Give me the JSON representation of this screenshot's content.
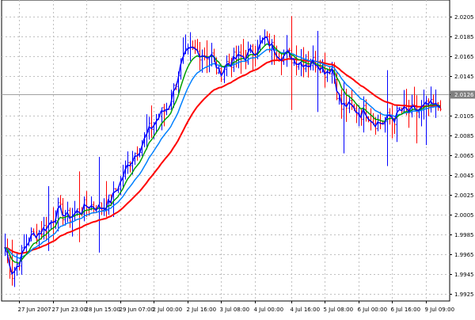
{
  "chart_data": {
    "type": "line",
    "title": "",
    "xlabel": "",
    "ylabel": "",
    "ylim": [
      1.9918,
      2.0215
    ],
    "grid": true,
    "legend": "none",
    "colors": {
      "price": "#0000ff",
      "bar_up": "#0000ff",
      "bar_down": "#ff0000",
      "ma_fast": "#00a000",
      "ma_mid": "#0080ff",
      "ma_slow": "#ff0000",
      "grid": "#c0c0c0",
      "current_line": "#a0a0a0",
      "current_label_bg": "#808080"
    },
    "yticks": [
      "2.0205",
      "2.0185",
      "2.0165",
      "2.0145",
      "2.0126",
      "2.0105",
      "2.0085",
      "2.0065",
      "2.0045",
      "2.0025",
      "2.0005",
      "1.9985",
      "1.9965",
      "1.9945",
      "1.9925"
    ],
    "ytick_values": [
      2.0205,
      2.0185,
      2.0165,
      2.0145,
      2.0126,
      2.0105,
      2.0085,
      2.0065,
      2.0045,
      2.0025,
      2.0005,
      1.9985,
      1.9965,
      1.9945,
      1.9925
    ],
    "current_price": 2.0126,
    "current_price_label": "2.0126",
    "xticks": [
      {
        "label": "27 Jun 2007",
        "i": 6
      },
      {
        "label": "27 Jun 23:00",
        "i": 20
      },
      {
        "label": "28 Jun 15:00",
        "i": 34
      },
      {
        "label": "29 Jun 07:00",
        "i": 48
      },
      {
        "label": "2 Jul 00:00",
        "i": 62
      },
      {
        "label": "2 Jul 16:00",
        "i": 76
      },
      {
        "label": "3 Jul 08:00",
        "i": 90
      },
      {
        "label": "4 Jul 00:00",
        "i": 104
      },
      {
        "label": "4 Jul 16:00",
        "i": 119
      },
      {
        "label": "5 Jul 08:00",
        "i": 133
      },
      {
        "label": "6 Jul 00:00",
        "i": 147
      },
      {
        "label": "6 Jul 16:00",
        "i": 161
      },
      {
        "label": "9 Jul 09:00",
        "i": 175
      }
    ],
    "bars_count": 182,
    "anchor_points": [
      [
        0,
        1.9972
      ],
      [
        3,
        1.9945
      ],
      [
        6,
        1.996
      ],
      [
        10,
        1.9982
      ],
      [
        14,
        1.9988
      ],
      [
        18,
        1.9995
      ],
      [
        22,
        2.001
      ],
      [
        26,
        2.0002
      ],
      [
        30,
        2.0008
      ],
      [
        35,
        2.0015
      ],
      [
        40,
        2.0012
      ],
      [
        44,
        2.002
      ],
      [
        48,
        2.004
      ],
      [
        52,
        2.006
      ],
      [
        56,
        2.0075
      ],
      [
        60,
        2.009
      ],
      [
        64,
        2.0105
      ],
      [
        68,
        2.0115
      ],
      [
        71,
        2.014
      ],
      [
        73,
        2.0158
      ],
      [
        75,
        2.0165
      ],
      [
        78,
        2.017
      ],
      [
        82,
        2.0168
      ],
      [
        86,
        2.0165
      ],
      [
        89,
        2.0145
      ],
      [
        92,
        2.0158
      ],
      [
        96,
        2.0162
      ],
      [
        100,
        2.0165
      ],
      [
        104,
        2.0172
      ],
      [
        108,
        2.0182
      ],
      [
        110,
        2.0175
      ],
      [
        114,
        2.0168
      ],
      [
        118,
        2.0165
      ],
      [
        122,
        2.016
      ],
      [
        126,
        2.0158
      ],
      [
        130,
        2.016
      ],
      [
        133,
        2.015
      ],
      [
        136,
        2.0155
      ],
      [
        138,
        2.013
      ],
      [
        140,
        2.0112
      ],
      [
        142,
        2.0115
      ],
      [
        145,
        2.011
      ],
      [
        148,
        2.0108
      ],
      [
        150,
        2.011
      ],
      [
        153,
        2.01
      ],
      [
        156,
        2.0098
      ],
      [
        158,
        2.0098
      ],
      [
        160,
        2.0105
      ],
      [
        162,
        2.0102
      ],
      [
        164,
        2.011
      ],
      [
        168,
        2.0108
      ],
      [
        172,
        2.011
      ],
      [
        176,
        2.0114
      ],
      [
        179,
        2.0112
      ],
      [
        181,
        2.0118
      ]
    ],
    "ma_fast_period": 8,
    "ma_mid_period": 16,
    "ma_slow_period": 34
  }
}
